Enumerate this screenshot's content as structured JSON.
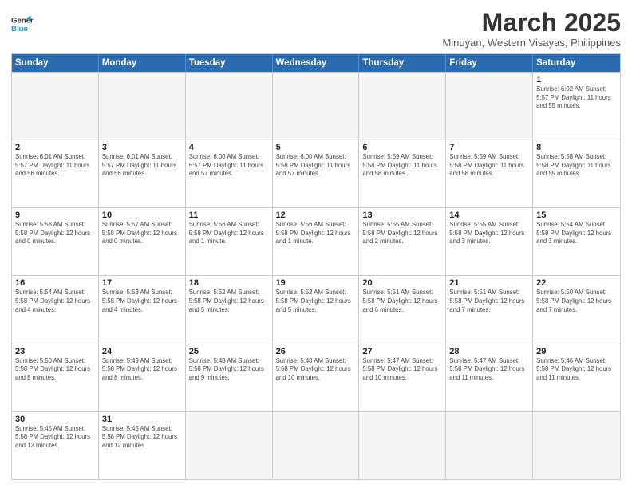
{
  "header": {
    "logo_general": "General",
    "logo_blue": "Blue",
    "month_year": "March 2025",
    "location": "Minuyan, Western Visayas, Philippines"
  },
  "weekdays": [
    "Sunday",
    "Monday",
    "Tuesday",
    "Wednesday",
    "Thursday",
    "Friday",
    "Saturday"
  ],
  "weeks": [
    [
      {
        "day": "",
        "info": ""
      },
      {
        "day": "",
        "info": ""
      },
      {
        "day": "",
        "info": ""
      },
      {
        "day": "",
        "info": ""
      },
      {
        "day": "",
        "info": ""
      },
      {
        "day": "",
        "info": ""
      },
      {
        "day": "1",
        "info": "Sunrise: 6:02 AM\nSunset: 5:57 PM\nDaylight: 11 hours and 55 minutes."
      }
    ],
    [
      {
        "day": "2",
        "info": "Sunrise: 6:01 AM\nSunset: 5:57 PM\nDaylight: 11 hours and 56 minutes."
      },
      {
        "day": "3",
        "info": "Sunrise: 6:01 AM\nSunset: 5:57 PM\nDaylight: 11 hours and 56 minutes."
      },
      {
        "day": "4",
        "info": "Sunrise: 6:00 AM\nSunset: 5:57 PM\nDaylight: 11 hours and 57 minutes."
      },
      {
        "day": "5",
        "info": "Sunrise: 6:00 AM\nSunset: 5:58 PM\nDaylight: 11 hours and 57 minutes."
      },
      {
        "day": "6",
        "info": "Sunrise: 5:59 AM\nSunset: 5:58 PM\nDaylight: 11 hours and 58 minutes."
      },
      {
        "day": "7",
        "info": "Sunrise: 5:59 AM\nSunset: 5:58 PM\nDaylight: 11 hours and 58 minutes."
      },
      {
        "day": "8",
        "info": "Sunrise: 5:58 AM\nSunset: 5:58 PM\nDaylight: 11 hours and 59 minutes."
      }
    ],
    [
      {
        "day": "9",
        "info": "Sunrise: 5:58 AM\nSunset: 5:58 PM\nDaylight: 12 hours and 0 minutes."
      },
      {
        "day": "10",
        "info": "Sunrise: 5:57 AM\nSunset: 5:58 PM\nDaylight: 12 hours and 0 minutes."
      },
      {
        "day": "11",
        "info": "Sunrise: 5:56 AM\nSunset: 5:58 PM\nDaylight: 12 hours and 1 minute."
      },
      {
        "day": "12",
        "info": "Sunrise: 5:56 AM\nSunset: 5:58 PM\nDaylight: 12 hours and 1 minute."
      },
      {
        "day": "13",
        "info": "Sunrise: 5:55 AM\nSunset: 5:58 PM\nDaylight: 12 hours and 2 minutes."
      },
      {
        "day": "14",
        "info": "Sunrise: 5:55 AM\nSunset: 5:58 PM\nDaylight: 12 hours and 3 minutes."
      },
      {
        "day": "15",
        "info": "Sunrise: 5:54 AM\nSunset: 5:58 PM\nDaylight: 12 hours and 3 minutes."
      }
    ],
    [
      {
        "day": "16",
        "info": "Sunrise: 5:54 AM\nSunset: 5:58 PM\nDaylight: 12 hours and 4 minutes."
      },
      {
        "day": "17",
        "info": "Sunrise: 5:53 AM\nSunset: 5:58 PM\nDaylight: 12 hours and 4 minutes."
      },
      {
        "day": "18",
        "info": "Sunrise: 5:52 AM\nSunset: 5:58 PM\nDaylight: 12 hours and 5 minutes."
      },
      {
        "day": "19",
        "info": "Sunrise: 5:52 AM\nSunset: 5:58 PM\nDaylight: 12 hours and 5 minutes."
      },
      {
        "day": "20",
        "info": "Sunrise: 5:51 AM\nSunset: 5:58 PM\nDaylight: 12 hours and 6 minutes."
      },
      {
        "day": "21",
        "info": "Sunrise: 5:51 AM\nSunset: 5:58 PM\nDaylight: 12 hours and 7 minutes."
      },
      {
        "day": "22",
        "info": "Sunrise: 5:50 AM\nSunset: 5:58 PM\nDaylight: 12 hours and 7 minutes."
      }
    ],
    [
      {
        "day": "23",
        "info": "Sunrise: 5:50 AM\nSunset: 5:58 PM\nDaylight: 12 hours and 8 minutes."
      },
      {
        "day": "24",
        "info": "Sunrise: 5:49 AM\nSunset: 5:58 PM\nDaylight: 12 hours and 8 minutes."
      },
      {
        "day": "25",
        "info": "Sunrise: 5:48 AM\nSunset: 5:58 PM\nDaylight: 12 hours and 9 minutes."
      },
      {
        "day": "26",
        "info": "Sunrise: 5:48 AM\nSunset: 5:58 PM\nDaylight: 12 hours and 10 minutes."
      },
      {
        "day": "27",
        "info": "Sunrise: 5:47 AM\nSunset: 5:58 PM\nDaylight: 12 hours and 10 minutes."
      },
      {
        "day": "28",
        "info": "Sunrise: 5:47 AM\nSunset: 5:58 PM\nDaylight: 12 hours and 11 minutes."
      },
      {
        "day": "29",
        "info": "Sunrise: 5:46 AM\nSunset: 5:58 PM\nDaylight: 12 hours and 11 minutes."
      }
    ],
    [
      {
        "day": "30",
        "info": "Sunrise: 5:45 AM\nSunset: 5:58 PM\nDaylight: 12 hours and 12 minutes."
      },
      {
        "day": "31",
        "info": "Sunrise: 5:45 AM\nSunset: 5:58 PM\nDaylight: 12 hours and 12 minutes."
      },
      {
        "day": "",
        "info": ""
      },
      {
        "day": "",
        "info": ""
      },
      {
        "day": "",
        "info": ""
      },
      {
        "day": "",
        "info": ""
      },
      {
        "day": "",
        "info": ""
      }
    ]
  ]
}
